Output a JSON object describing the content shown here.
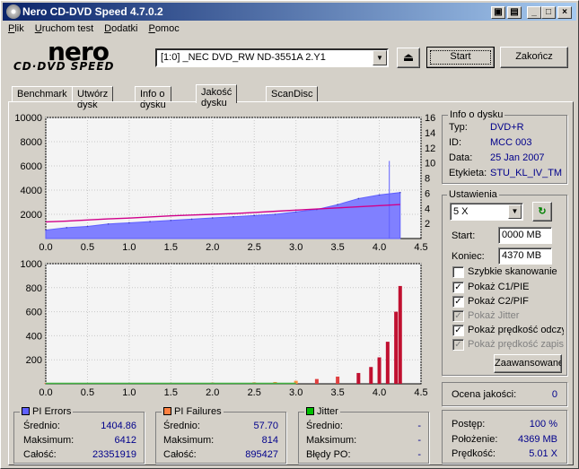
{
  "window": {
    "title": "Nero CD-DVD Speed 4.7.0.2"
  },
  "menu": [
    "Plik",
    "Uruchom test",
    "Dodatki",
    "Pomoc"
  ],
  "logo": {
    "top": "nero",
    "bottom": "CD·DVD SPEED"
  },
  "drive": {
    "selected": "[1:0]   _NEC DVD_RW ND-3551A 2.Y1"
  },
  "buttons": {
    "start": "Start",
    "exit": "Zakończ",
    "advanced": "Zaawansowane"
  },
  "tabs": [
    "Benchmark",
    "Utwórz dysk",
    "Info o dysku",
    "Jakość dysku",
    "ScanDisc"
  ],
  "disc_info": {
    "title": "Info o dysku",
    "type_label": "Typ:",
    "type": "DVD+R",
    "id_label": "ID:",
    "id": "MCC 003",
    "date_label": "Data:",
    "date": "25 Jan 2007",
    "label_label": "Etykieta:",
    "label": "STU_KL_IV_TM"
  },
  "settings": {
    "title": "Ustawienia",
    "speed": "5 X",
    "start_label": "Start:",
    "start": "0000 MB",
    "end_label": "Koniec:",
    "end": "4370 MB",
    "options": [
      {
        "label": "Szybkie skanowanie",
        "checked": false,
        "disabled": false
      },
      {
        "label": "Pokaż C1/PIE",
        "checked": true,
        "disabled": false
      },
      {
        "label": "Pokaż C2/PIF",
        "checked": true,
        "disabled": false
      },
      {
        "label": "Pokaż Jitter",
        "checked": true,
        "disabled": true
      },
      {
        "label": "Pokaż prędkość odczytu",
        "checked": true,
        "disabled": false
      },
      {
        "label": "Pokaż prędkość zapisu",
        "checked": true,
        "disabled": true
      }
    ]
  },
  "quality": {
    "label": "Ocena jakości:",
    "value": "0"
  },
  "progress": {
    "progress_label": "Postęp:",
    "progress": "100 %",
    "position_label": "Położenie:",
    "position": "4369 MB",
    "speed_label": "Prędkość:",
    "speed": "5.01 X"
  },
  "pi_errors": {
    "title": "PI Errors",
    "color": "#6060ff",
    "avg_label": "Średnio:",
    "avg": "1404.86",
    "max_label": "Maksimum:",
    "max": "6412",
    "total_label": "Całość:",
    "total": "23351919"
  },
  "pi_failures": {
    "title": "PI Failures",
    "color": "#ff8040",
    "avg_label": "Średnio:",
    "avg": "57.70",
    "max_label": "Maksimum:",
    "max": "814",
    "total_label": "Całość:",
    "total": "895427"
  },
  "jitter": {
    "title": "Jitter",
    "color": "#00c000",
    "avg_label": "Średnio:",
    "avg": "-",
    "max_label": "Maksimum:",
    "max": "-",
    "po_label": "Błędy PO:",
    "po": "-"
  },
  "chart_data": [
    {
      "type": "area",
      "title": "PI Errors",
      "x": [
        0,
        0.25,
        0.5,
        0.75,
        1.0,
        1.25,
        1.5,
        1.75,
        2.0,
        2.25,
        2.5,
        2.75,
        3.0,
        3.25,
        3.5,
        3.75,
        4.0,
        4.25
      ],
      "series": [
        {
          "name": "PI Errors",
          "values": [
            700,
            900,
            1000,
            1200,
            1300,
            1400,
            1500,
            1600,
            1700,
            1800,
            1900,
            2000,
            2200,
            2400,
            2800,
            3300,
            3600,
            3800
          ]
        }
      ],
      "speed_series": {
        "axis": "right",
        "values": [
          2.2,
          2.3,
          2.45,
          2.6,
          2.7,
          2.85,
          3.0,
          3.1,
          3.2,
          3.3,
          3.45,
          3.6,
          3.75,
          3.9,
          4.05,
          4.2,
          4.35,
          4.5
        ]
      },
      "xlim": [
        0,
        4.5
      ],
      "ylim": [
        0,
        10000
      ],
      "y2lim": [
        0,
        16
      ],
      "xticks": [
        "0.0",
        "0.5",
        "1.0",
        "1.5",
        "2.0",
        "2.5",
        "3.0",
        "3.5",
        "4.0",
        "4.5"
      ],
      "yticks": [
        "2000",
        "4000",
        "6000",
        "8000",
        "10000"
      ],
      "y2ticks": [
        "2",
        "4",
        "6",
        "8",
        "10",
        "12",
        "14",
        "16"
      ]
    },
    {
      "type": "bar",
      "title": "PI Failures",
      "x": [
        0,
        0.5,
        1.0,
        1.5,
        2.0,
        2.5,
        2.75,
        3.0,
        3.25,
        3.5,
        3.75,
        3.9,
        4.0,
        4.1,
        4.2,
        4.25
      ],
      "series": [
        {
          "name": "PI Failures",
          "values": [
            4,
            5,
            6,
            8,
            10,
            12,
            15,
            25,
            40,
            60,
            90,
            140,
            220,
            350,
            600,
            814
          ]
        }
      ],
      "xlim": [
        0,
        4.5
      ],
      "ylim": [
        0,
        1000
      ],
      "xticks": [
        "0.0",
        "0.5",
        "1.0",
        "1.5",
        "2.0",
        "2.5",
        "3.0",
        "3.5",
        "4.0",
        "4.5"
      ],
      "yticks": [
        "200",
        "400",
        "600",
        "800",
        "1000"
      ]
    }
  ]
}
